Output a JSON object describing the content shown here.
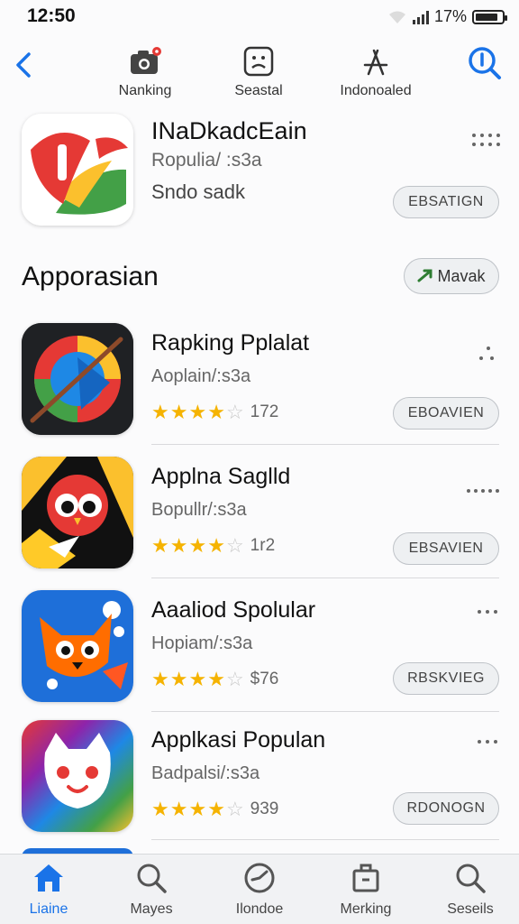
{
  "status": {
    "time": "12:50",
    "battery": "17%",
    "battery_level": 0.85
  },
  "nav": {
    "items": [
      {
        "label": "Nanking"
      },
      {
        "label": "Seastal"
      },
      {
        "label": "Indonoaled"
      }
    ]
  },
  "featured": {
    "title": "INaDkadcEain",
    "subtitle": "Ropulia/ :s3a",
    "subtitle2": "Sndo sadk",
    "button": "EBSATIGN"
  },
  "section": {
    "title": "Apporasian",
    "button": "Mavak"
  },
  "apps": [
    {
      "name": "Rapking Pplalat",
      "category": "Aoplain/:s3a",
      "stars": 4,
      "count": "172",
      "button": "EBOAVIEN"
    },
    {
      "name": "Applna Saglld",
      "category": "Bopullr/:s3a",
      "stars": 4,
      "count": "1r2",
      "button": "EBSAVIEN"
    },
    {
      "name": "Aaaliod Spolular",
      "category": "Hopiam/:s3a",
      "stars": 4,
      "count": "$76",
      "button": "RBSKVIEG"
    },
    {
      "name": "Applkasi Populan",
      "category": "Badpalsi/:s3a",
      "stars": 4,
      "count": "939",
      "button": "RDONOGN"
    }
  ],
  "tabs": [
    {
      "label": "Liaine"
    },
    {
      "label": "Mayes"
    },
    {
      "label": "Ilondoe"
    },
    {
      "label": "Merking"
    },
    {
      "label": "Seseils"
    }
  ],
  "colors": {
    "accent": "#1a73e8",
    "star": "#f5b301",
    "pill_bg": "#eef0f2"
  }
}
